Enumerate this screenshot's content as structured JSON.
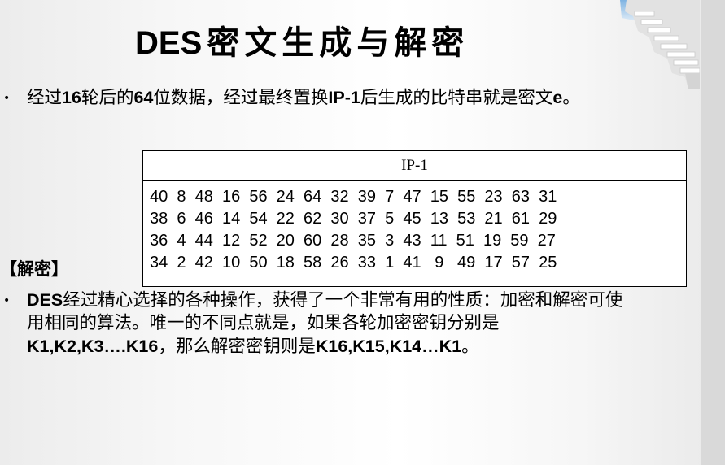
{
  "slide": {
    "title_latin": "DES",
    "title_cjk": "密文生成与解密"
  },
  "bullet1": {
    "parts": [
      "经过",
      "16",
      "轮后的",
      "64",
      "位数据，经过最终置换",
      "IP-1",
      "后生成的比特串就是密文",
      "e",
      "。"
    ]
  },
  "table": {
    "header": "IP-1",
    "rows": [
      "40  8  48  16  56  24  64  32  39  7  47  15  55  23  63  31",
      "38  6  46  14  54  22  62  30  37  5  45  13  53  21  61  29",
      "36  4  44  12  52  20  60  28  35  3  43  11  51  19  59  27",
      "34  2  42  10  50  18  58  26  33  1  41   9   49  17  57  25"
    ]
  },
  "section": {
    "label": "【解密】"
  },
  "bullet2": {
    "parts": [
      "DES",
      "经过精心选择的各种操作，获得了一个非常有用的性质：加密和解密可使用相同的算法。唯一的不同点就是，如果各轮加密密钥分别是",
      "K1,K2,K3….K16",
      "，那么解密密钥则是",
      "K16,K15,K14…K1",
      "。"
    ]
  },
  "bullet_symbol": "•",
  "colors": {
    "background": "#f7f7f7",
    "right_band": "#d9d9d9",
    "text": "#000000"
  },
  "icons": {
    "decoration": "staircase-decoration"
  }
}
